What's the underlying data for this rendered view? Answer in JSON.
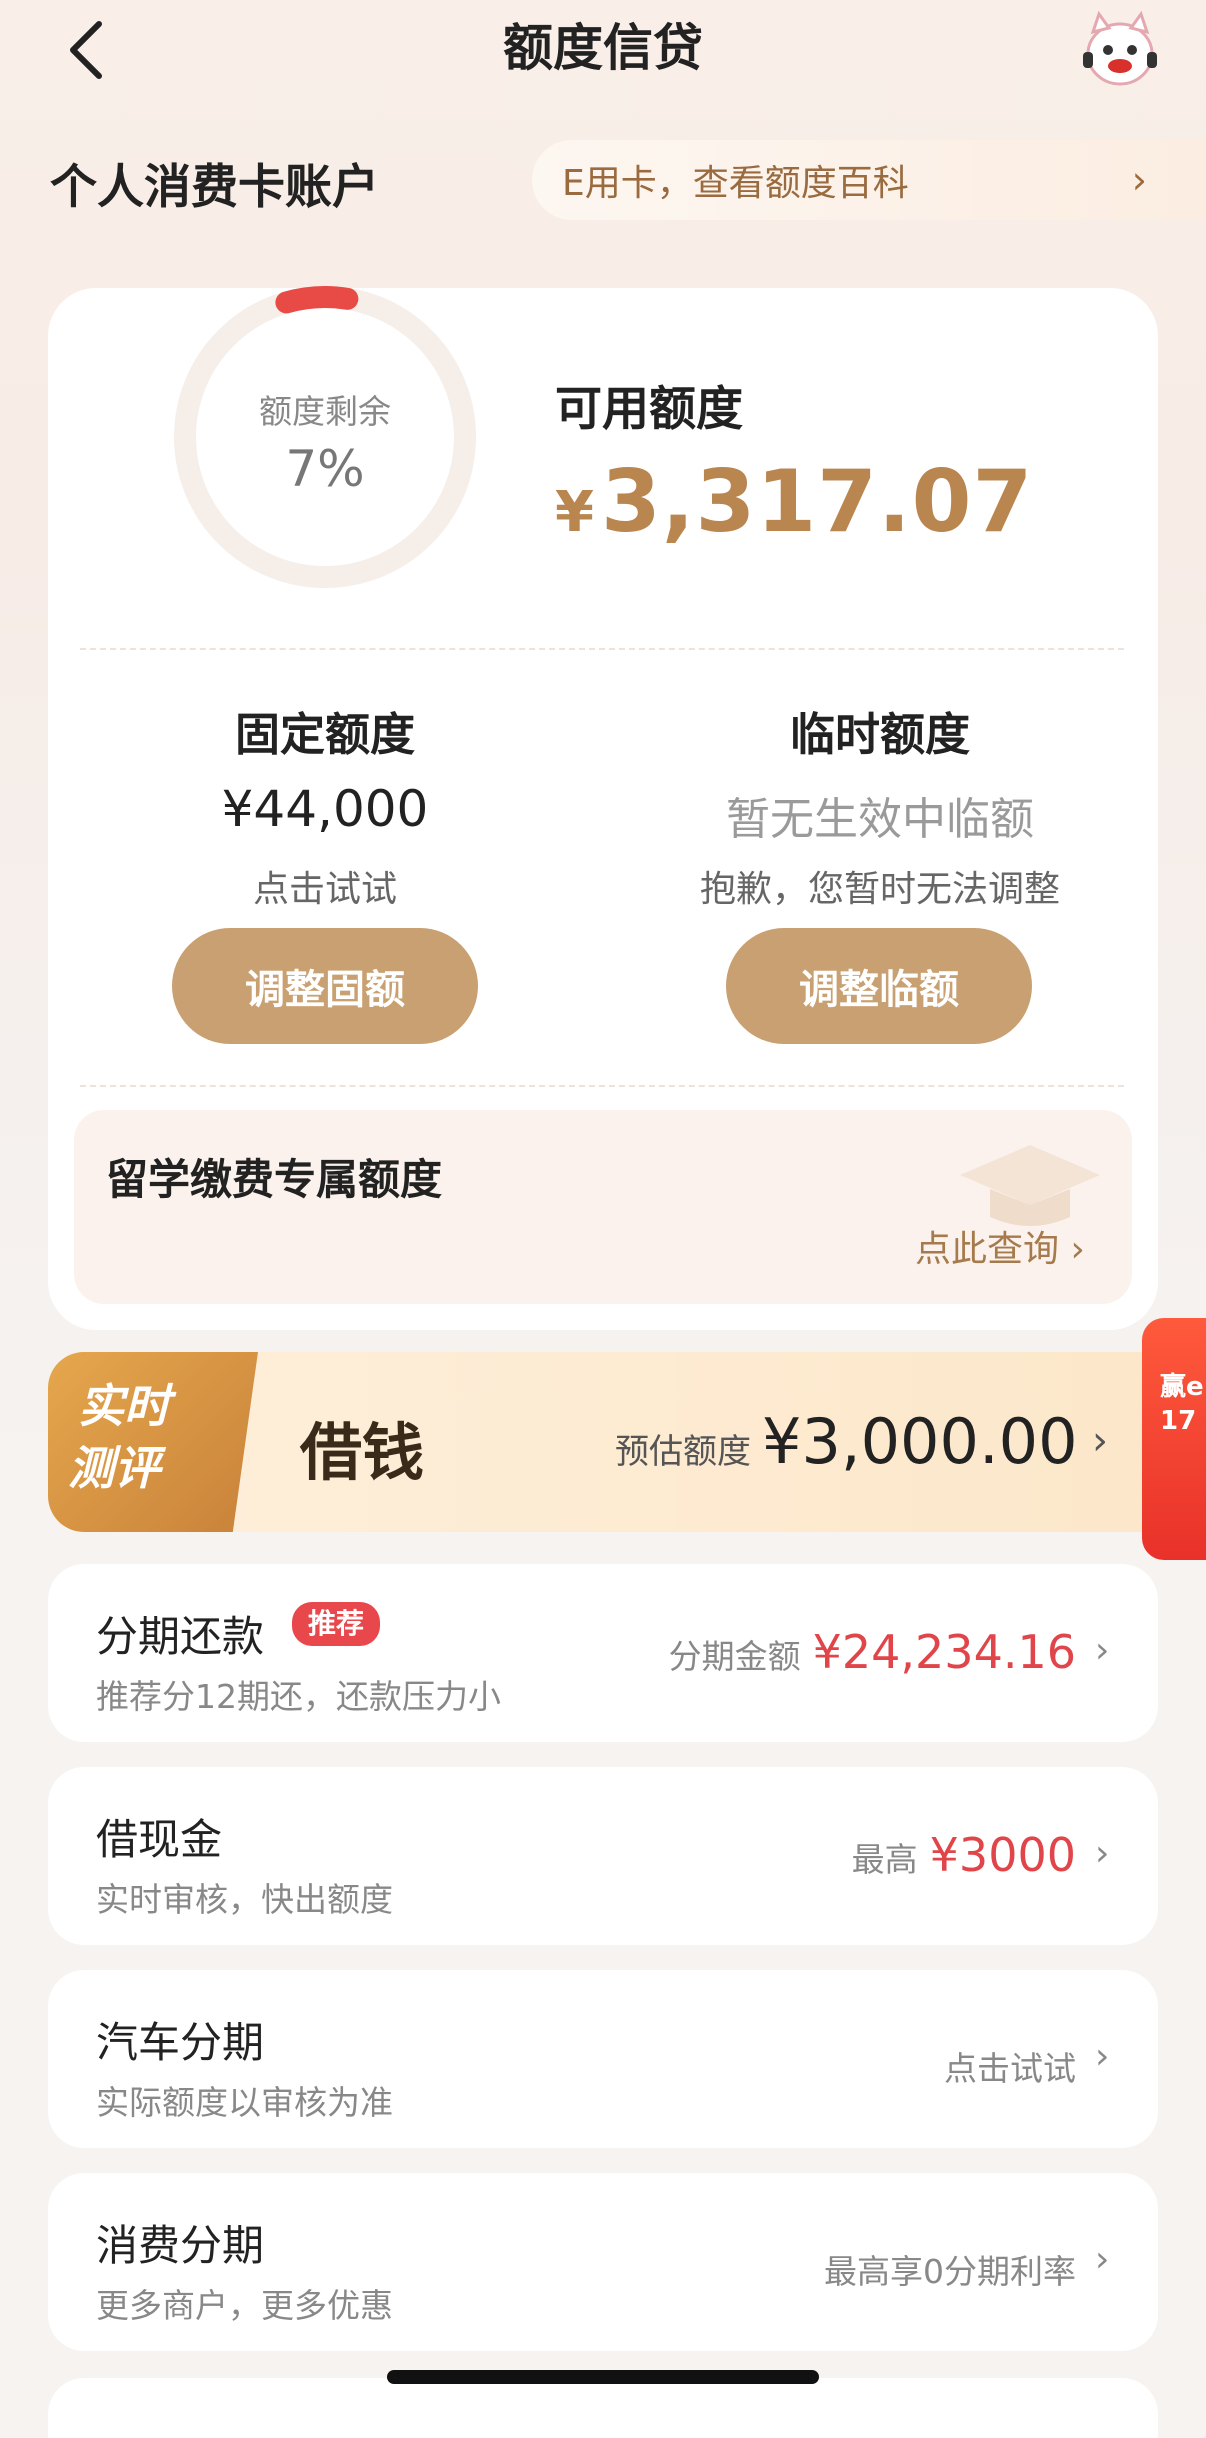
{
  "header": {
    "title": "额度信贷",
    "back_icon": "chevron-left-icon",
    "mascot_icon": "mascot-icon"
  },
  "account": {
    "section_title": "个人消费卡账户",
    "hint_text": "E用卡，查看额度百科"
  },
  "quota": {
    "ring_label": "额度剩余",
    "ring_percent_text": "7%",
    "ring_fraction": 0.07,
    "available_label": "可用额度",
    "available_currency": "¥",
    "available_amount": "3,317.07"
  },
  "fixed": {
    "title": "固定额度",
    "value": "¥44,000",
    "sub": "点击试试",
    "button": "调整固额"
  },
  "temp": {
    "title": "临时额度",
    "value": "暂无生效中临额",
    "sub": "抱歉，您暂时无法调整",
    "button": "调整临额"
  },
  "study": {
    "title": "留学缴费专属额度",
    "link": "点此查询"
  },
  "borrow": {
    "tag_line1": "实时",
    "tag_line2": "测评",
    "title": "借钱",
    "est_label": "预估额度",
    "amount": "¥3,000.00"
  },
  "side_promo": {
    "line1": "赢e",
    "line2": "17"
  },
  "list": [
    {
      "title": "分期还款",
      "badge": "推荐",
      "sub": "推荐分12期还，还款压力小",
      "right_label": "分期金额",
      "right_value": "¥24,234.16"
    },
    {
      "title": "借现金",
      "sub": "实时审核，快出额度",
      "right_label": "最高",
      "right_value": "¥3000"
    },
    {
      "title": "汽车分期",
      "sub": "实际额度以审核为准",
      "right_label": "点击试试"
    },
    {
      "title": "消费分期",
      "sub": "更多商户，更多优惠",
      "right_label": "最高享0分期利率"
    }
  ],
  "colors": {
    "accent_gold": "#c9a071",
    "amount_gold": "#b98650",
    "red": "#e0454a",
    "ring_red": "#e84a45"
  }
}
